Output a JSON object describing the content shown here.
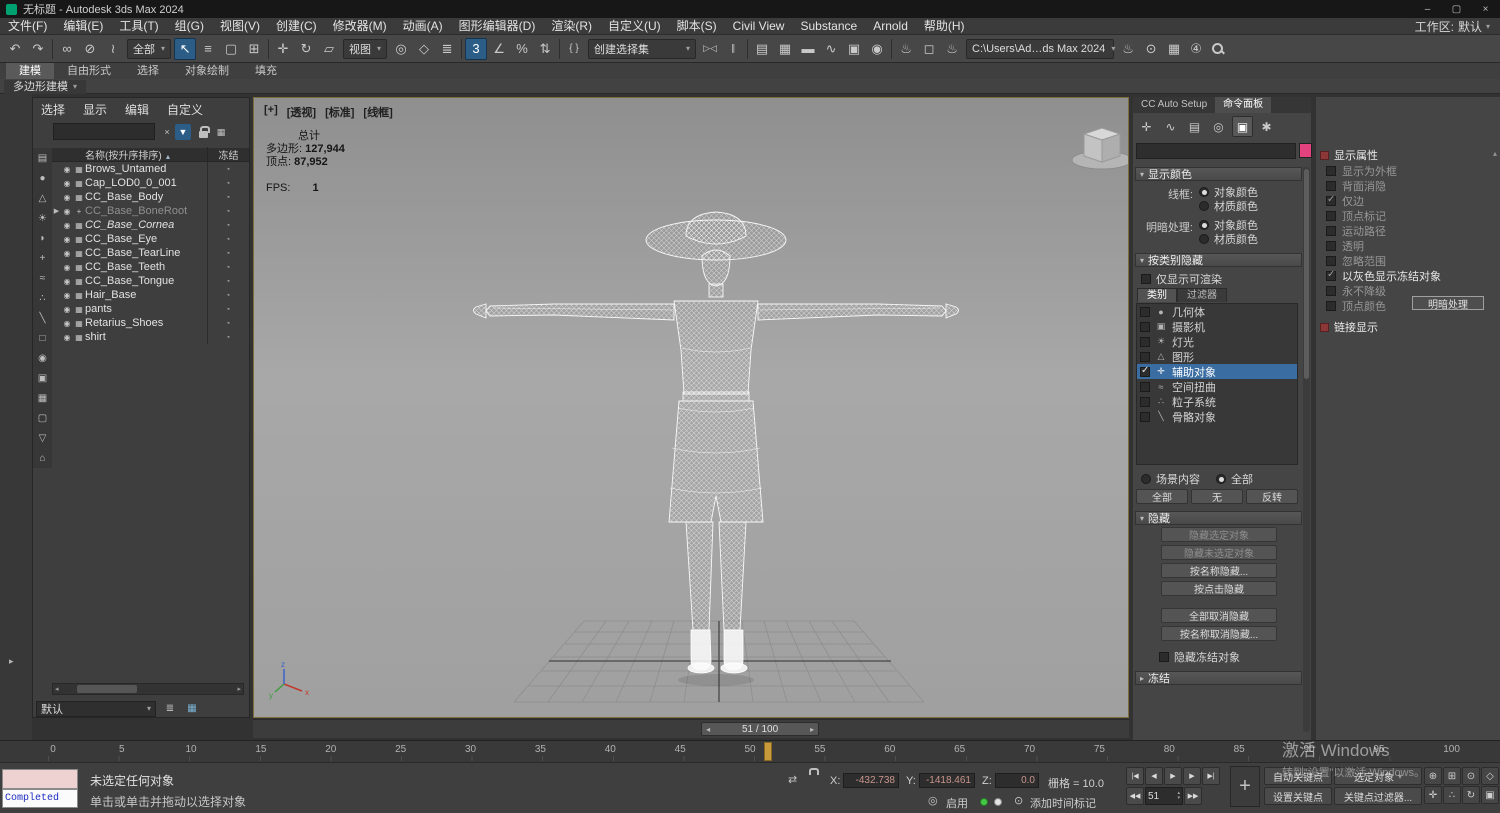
{
  "colors": {
    "accent_blue": "#2c5d87",
    "selection_blue": "#3a6da2",
    "swatch_pink": "#e2437e",
    "playhead_orange": "#c79a3c",
    "enable_green": "#43c943",
    "logo_teal": "#00a170"
  },
  "ui": {
    "caret": "▾",
    "caret_left": "◂",
    "caret_right": "▸",
    "sort_asc": "▲",
    "ro_open": "▾",
    "ro_closed": "▸",
    "min": "–",
    "max": "▢",
    "close": "×",
    "clear": "×",
    "funnel": "▼",
    "spinner_up": "▴",
    "spinner_down": "▾",
    "scroll_up": "▴",
    "plus": "+",
    "handle": "▸",
    "hscroll_left": "◂",
    "hscroll_right": "▸"
  },
  "titlebar": {
    "title": "无标题 - Autodesk 3ds Max 2024"
  },
  "menubar": {
    "items": [
      "文件(F)",
      "编辑(E)",
      "工具(T)",
      "组(G)",
      "视图(V)",
      "创建(C)",
      "修改器(M)",
      "动画(A)",
      "图形编辑器(D)",
      "渲染(R)",
      "自定义(U)",
      "脚本(S)",
      "Civil View",
      "Substance",
      "Arnold",
      "帮助(H)"
    ],
    "workspace_label": "工作区:",
    "workspace_value": "默认"
  },
  "toolbar": {
    "history": [
      {
        "name": "undo-icon",
        "glyph": "↶"
      },
      {
        "name": "redo-icon",
        "glyph": "↷"
      }
    ],
    "link": [
      {
        "name": "select-and-link-icon",
        "glyph": "∞"
      },
      {
        "name": "unlink-selection-icon",
        "glyph": "⊘"
      },
      {
        "name": "bind-to-space-warp-icon",
        "glyph": "≀"
      }
    ],
    "filter_value": "全部",
    "select": [
      {
        "name": "select-object-icon",
        "glyph": "↖",
        "active": true
      },
      {
        "name": "select-by-name-icon",
        "glyph": "≡"
      },
      {
        "name": "rectangular-selection-region-icon",
        "glyph": "▢"
      },
      {
        "name": "window-crossing-icon",
        "glyph": "⊞"
      }
    ],
    "transform": [
      {
        "name": "select-and-move-icon",
        "glyph": "✛"
      },
      {
        "name": "select-and-rotate-icon",
        "glyph": "↻"
      },
      {
        "name": "select-and-scale-icon",
        "glyph": "▱"
      }
    ],
    "refcoord_value": "视图",
    "pivot": [
      {
        "name": "use-pivot-point-icon",
        "glyph": "◎"
      },
      {
        "name": "select-and-manipulate-icon",
        "glyph": "◇"
      },
      {
        "name": "keyboard-override-icon",
        "glyph": "≣"
      }
    ],
    "snaps": [
      {
        "name": "snaps-toggle-icon",
        "glyph": "3",
        "active": true
      },
      {
        "name": "angle-snap-icon",
        "glyph": "∠"
      },
      {
        "name": "percent-snap-icon",
        "glyph": "%"
      },
      {
        "name": "spinner-snap-icon",
        "glyph": "⇅"
      }
    ],
    "selset_icon": [
      {
        "name": "edit-named-selection-sets-icon",
        "glyph": "{ }"
      }
    ],
    "selset_value": "创建选择集",
    "mirror_align": [
      {
        "name": "mirror-icon",
        "glyph": "▷◁"
      },
      {
        "name": "align-icon",
        "glyph": "∥"
      }
    ],
    "editors": [
      {
        "name": "toggle-scene-explorer-icon",
        "glyph": "▤"
      },
      {
        "name": "toggle-layer-explorer-icon",
        "glyph": "▦"
      },
      {
        "name": "toggle-ribbon-icon",
        "glyph": "▬"
      },
      {
        "name": "curve-editor-icon",
        "glyph": "∿"
      },
      {
        "name": "schematic-view-icon",
        "glyph": "▣"
      },
      {
        "name": "material-editor-icon",
        "glyph": "◉"
      }
    ],
    "render": [
      {
        "name": "render-setup-icon",
        "glyph": "♨"
      },
      {
        "name": "rendered-frame-window-icon",
        "glyph": "◻"
      },
      {
        "name": "render-production-icon",
        "glyph": "♨"
      }
    ],
    "path_value": "C:\\Users\\Ad…ds Max 2024",
    "right_icons": [
      {
        "name": "render-iterative-icon",
        "glyph": "♨"
      },
      {
        "name": "open-in-cloud-icon",
        "glyph": "⊙"
      },
      {
        "name": "workspace-switch-icon",
        "glyph": "▦"
      }
    ],
    "badge_value": "④"
  },
  "ribbon": {
    "tabs": [
      {
        "label": "建模",
        "active": true
      },
      {
        "label": "自由形式"
      },
      {
        "label": "选择"
      },
      {
        "label": "对象绘制"
      },
      {
        "label": "填充"
      }
    ],
    "subtab": "多边形建模"
  },
  "explorer": {
    "menu": [
      "选择",
      "显示",
      "编辑",
      "自定义"
    ],
    "header_name": "名称(按升序排序)",
    "header_frozen": "冻结",
    "eye_glyph": "◉",
    "freeze_glyph": "▪",
    "strip": [
      {
        "name": "explorer-display-all-icon",
        "glyph": "▤"
      },
      {
        "name": "explorer-display-geometry-icon",
        "glyph": "●"
      },
      {
        "name": "explorer-display-shapes-icon",
        "glyph": "△"
      },
      {
        "name": "explorer-display-lights-icon",
        "glyph": "☀"
      },
      {
        "name": "explorer-display-cameras-icon",
        "glyph": "◗"
      },
      {
        "name": "explorer-display-helpers-icon",
        "glyph": "+"
      },
      {
        "name": "explorer-display-spacewarps-icon",
        "glyph": "≈"
      },
      {
        "name": "explorer-display-particles-icon",
        "glyph": "∴"
      },
      {
        "name": "explorer-display-bones-icon",
        "glyph": "╲"
      },
      {
        "name": "explorer-display-containers-icon",
        "glyph": "□"
      },
      {
        "name": "explorer-display-materials-icon",
        "glyph": "◉"
      },
      {
        "name": "explorer-display-xrefs-icon",
        "glyph": "▣"
      },
      {
        "name": "explorer-display-groups-icon",
        "glyph": "▦"
      },
      {
        "name": "explorer-lock-icon",
        "glyph": "▢"
      },
      {
        "name": "explorer-filter-icon",
        "glyph": "▽"
      },
      {
        "name": "explorer-folder-icon",
        "glyph": "⌂"
      }
    ],
    "rows": [
      {
        "name": "Brows_Untamed",
        "icon": "▦",
        "exp": ""
      },
      {
        "name": "Cap_LOD0_0_001",
        "icon": "▦",
        "exp": ""
      },
      {
        "name": "CC_Base_Body",
        "icon": "▦",
        "exp": ""
      },
      {
        "name": "CC_Base_BoneRoot",
        "icon": "+",
        "exp": "▶",
        "dim": true
      },
      {
        "name": "CC_Base_Cornea",
        "icon": "▦",
        "exp": "",
        "italic": true
      },
      {
        "name": "CC_Base_Eye",
        "icon": "▦",
        "exp": ""
      },
      {
        "name": "CC_Base_TearLine",
        "icon": "▦",
        "exp": ""
      },
      {
        "name": "CC_Base_Teeth",
        "icon": "▦",
        "exp": ""
      },
      {
        "name": "CC_Base_Tongue",
        "icon": "▦",
        "exp": ""
      },
      {
        "name": "Hair_Base",
        "icon": "▦",
        "exp": ""
      },
      {
        "name": "pants",
        "icon": "▦",
        "exp": ""
      },
      {
        "name": "Retarius_Shoes",
        "icon": "▦",
        "exp": ""
      },
      {
        "name": "shirt",
        "icon": "▦",
        "exp": ""
      }
    ],
    "preset_value": "默认"
  },
  "viewport": {
    "labels": [
      "[+]",
      "[透视]",
      "[标准]",
      "[线框]"
    ],
    "stats": {
      "total_label": "总计",
      "poly_label": "多边形:",
      "poly_value": "127,944",
      "vert_label": "顶点:",
      "vert_value": "87,952",
      "fps_label": "FPS:",
      "fps_value": "1"
    },
    "timebar": {
      "label": "51 / 100"
    }
  },
  "cmdpanel": {
    "tabs": [
      {
        "label": "CC Auto Setup"
      },
      {
        "label": "命令面板",
        "active": true
      }
    ],
    "panel_icons": [
      {
        "name": "create-tab-icon",
        "glyph": "✛"
      },
      {
        "name": "modify-tab-icon",
        "glyph": "∿"
      },
      {
        "name": "hierarchy-tab-icon",
        "glyph": "▤"
      },
      {
        "name": "motion-tab-icon",
        "glyph": "◎"
      },
      {
        "name": "display-tab-icon",
        "glyph": "▣",
        "active": true
      },
      {
        "name": "utilities-tab-icon",
        "glyph": "✱"
      }
    ],
    "display_color": {
      "title": "显示颜色",
      "wire_label": "线框:",
      "shade_label": "明暗处理:",
      "obj": "对象颜色",
      "mat": "材质颜色"
    },
    "hide_cat": {
      "title": "按类别隐藏",
      "only_label": "仅显示可渲染",
      "tabs": [
        {
          "label": "类别",
          "active": true
        },
        {
          "label": "过滤器"
        }
      ],
      "items": [
        {
          "label": "几何体",
          "glyph": "●"
        },
        {
          "label": "摄影机",
          "glyph": "▣"
        },
        {
          "label": "灯光",
          "glyph": "☀"
        },
        {
          "label": "图形",
          "glyph": "△"
        },
        {
          "label": "辅助对象",
          "glyph": "✛",
          "checked": true,
          "selected": true
        },
        {
          "label": "空间扭曲",
          "glyph": "≈"
        },
        {
          "label": "粒子系统",
          "glyph": "∴"
        },
        {
          "label": "骨骼对象",
          "glyph": "╲"
        }
      ],
      "scene_label": "场景内容",
      "all_label": "全部",
      "buttons": [
        "全部",
        "无",
        "反转"
      ]
    },
    "hide": {
      "title": "隐藏",
      "buttons": [
        {
          "label": "隐藏选定对象",
          "disabled": true
        },
        {
          "label": "隐藏未选定对象",
          "disabled": true
        },
        {
          "label": "按名称隐藏..."
        },
        {
          "label": "按点击隐藏"
        },
        {
          "label": "全部取消隐藏",
          "gap": true
        },
        {
          "label": "按名称取消隐藏..."
        }
      ],
      "freeze_cb": "隐藏冻结对象"
    },
    "freeze_title": "冻结"
  },
  "dsp": {
    "props_title": "显示属性",
    "items": [
      {
        "label": "显示为外框",
        "disabled": true
      },
      {
        "label": "背面消隐",
        "disabled": true
      },
      {
        "label": "仅边",
        "disabled": true,
        "checked": true
      },
      {
        "label": "顶点标记",
        "disabled": true
      },
      {
        "label": "运动路径",
        "disabled": true
      },
      {
        "label": "透明",
        "disabled": true
      },
      {
        "label": "忽略范围",
        "disabled": true
      },
      {
        "label": "以灰色显示冻结对象",
        "checked": true
      },
      {
        "label": "永不降级",
        "disabled": true
      },
      {
        "label": "顶点颜色",
        "disabled": true
      }
    ],
    "shaded_button": "明暗处理",
    "link_title": "链接显示"
  },
  "timeline": {
    "ticks": [
      "0",
      "5",
      "10",
      "15",
      "20",
      "25",
      "30",
      "35",
      "40",
      "45",
      "50",
      "55",
      "60",
      "65",
      "70",
      "75",
      "80",
      "85",
      "90",
      "95",
      "100"
    ],
    "current_frame": 51
  },
  "statusbar": {
    "listener_text": "Completed",
    "status1": "未选定任何对象",
    "status2": "单击或单击并拖动以选择对象",
    "x_label": "X:",
    "x_value": "-432.738",
    "y_label": "Y:",
    "y_value": "-1418.461",
    "z_label": "Z:",
    "z_value": "0.0",
    "grid_label": "栅格 = 10.0",
    "enable_label": "启用",
    "time_tag_label": "添加时间标记",
    "transport": [
      {
        "name": "go-to-start-button",
        "glyph": "|◀"
      },
      {
        "name": "previous-frame-button",
        "glyph": "◀"
      },
      {
        "name": "play-button",
        "glyph": "▶"
      },
      {
        "name": "next-frame-button",
        "glyph": "▶"
      },
      {
        "name": "go-to-end-button",
        "glyph": "▶|"
      }
    ],
    "transport2_prev": "◀◀",
    "transport2_next": "▶▶",
    "frame_value": "51",
    "keys": {
      "auto": "自动关键点",
      "selected": "选定对象",
      "set": "设置关键点",
      "filters": "关键点过滤器..."
    },
    "nav_icons": [
      {
        "name": "zoom-icon",
        "glyph": "⊕"
      },
      {
        "name": "zoom-all-icon",
        "glyph": "⊞"
      },
      {
        "name": "zoom-extents-icon",
        "glyph": "⊙"
      },
      {
        "name": "field-of-view-icon",
        "glyph": "◇"
      },
      {
        "name": "pan-icon",
        "glyph": "✛"
      },
      {
        "name": "walk-through-icon",
        "glyph": "∴"
      },
      {
        "name": "orbit-icon",
        "glyph": "↻"
      },
      {
        "name": "maximize-viewport-icon",
        "glyph": "▣"
      }
    ]
  },
  "watermark": {
    "line1": "激活 Windows",
    "line2": "转到“设置”以激活 Windows。"
  }
}
